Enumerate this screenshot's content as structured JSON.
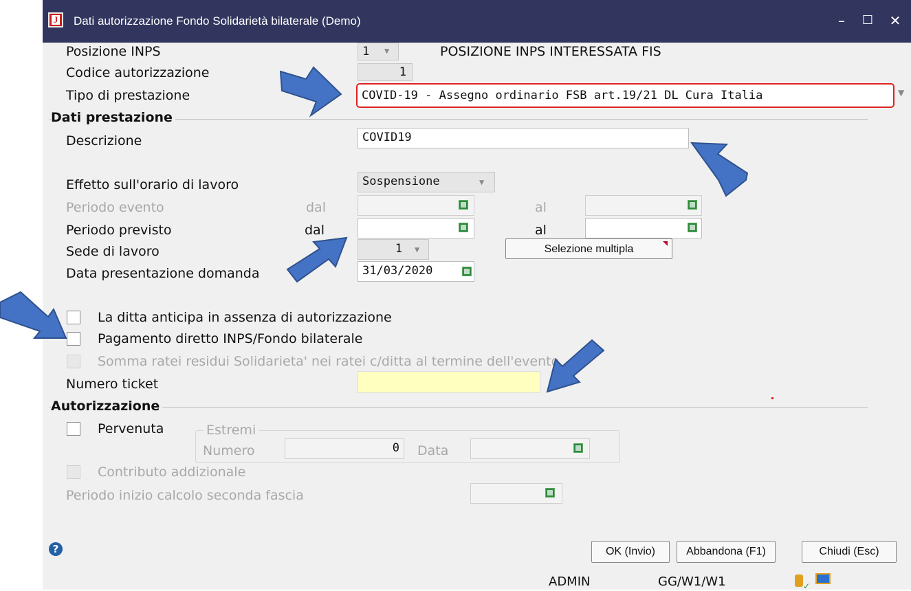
{
  "window": {
    "title": "Dati autorizzazione Fondo Solidarietà bilaterale (Demo)",
    "app_icon_letter": "J",
    "minimize": "–",
    "maximize": "☐",
    "close": "✕"
  },
  "posizione": {
    "label": "Posizione INPS",
    "value": "1",
    "description": "POSIZIONE INPS INTERESSATA FIS"
  },
  "codice": {
    "label": "Codice autorizzazione",
    "value": "1"
  },
  "tipo": {
    "label": "Tipo di prestazione",
    "value": "COVID-19 - Assegno ordinario FSB art.19/21 DL Cura Italia"
  },
  "dati_prestazione": {
    "title": "Dati prestazione",
    "descrizione_label": "Descrizione",
    "descrizione_value": "COVID19",
    "effetto_label": "Effetto sull'orario di lavoro",
    "effetto_value": "Sospensione",
    "periodo_evento_label": "Periodo evento",
    "dal": "dal",
    "al": "al",
    "periodo_previsto_label": "Periodo previsto",
    "sede_label": "Sede di lavoro",
    "sede_value": "1",
    "selezione_label": "Selezione multipla",
    "data_label": "Data presentazione domanda",
    "data_value": "31/03/2020",
    "anticipa_label": "La ditta anticipa in assenza di autorizzazione",
    "pagamento_label": "Pagamento diretto INPS/Fondo bilaterale",
    "somma_label": "Somma ratei residui Solidarieta' nei ratei c/ditta al termine dell'evento",
    "ticket_label": "Numero ticket",
    "ticket_value": ""
  },
  "autorizzazione": {
    "title": "Autorizzazione",
    "pervenuta_label": "Pervenuta",
    "estremi_label": "Estremi",
    "numero_label": "Numero",
    "numero_value": "0",
    "data_label": "Data",
    "contributo_label": "Contributo addizionale",
    "periodo_label": "Periodo inizio calcolo seconda fascia"
  },
  "buttons": {
    "ok": "OK (Invio)",
    "abbandona": "Abbandona (F1)",
    "chiudi": "Chiudi (Esc)"
  },
  "status": {
    "user": "ADMIN",
    "code": "GG/W1/W1"
  },
  "colors": {
    "titlebar": "#32355e",
    "accent_arrow": "#4472c4",
    "highlight": "#e02020",
    "ticket": "#ffffc0"
  }
}
